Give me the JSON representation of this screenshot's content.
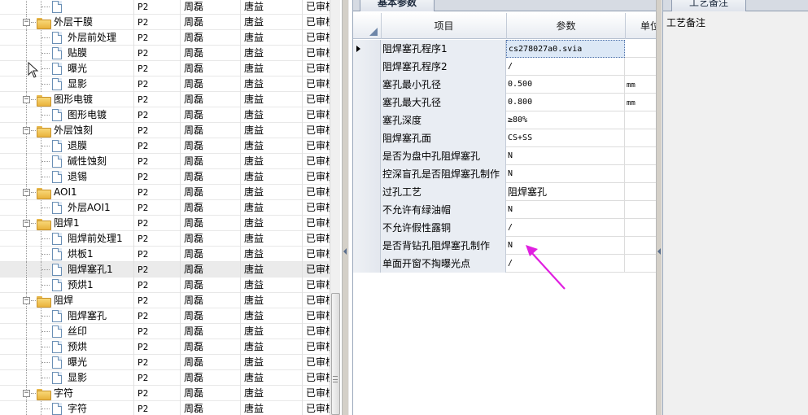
{
  "tree": {
    "rows": [
      {
        "kind": "doc",
        "label": "",
        "version": "P2",
        "maker": "周磊",
        "auditor": "唐益",
        "status": "已审核"
      },
      {
        "kind": "folder",
        "label": "外层干膜",
        "version": "P2",
        "maker": "周磊",
        "auditor": "唐益",
        "status": "已审核"
      },
      {
        "kind": "doc",
        "label": "外层前处理",
        "version": "P2",
        "maker": "周磊",
        "auditor": "唐益",
        "status": "已审核"
      },
      {
        "kind": "doc",
        "label": "贴膜",
        "version": "P2",
        "maker": "周磊",
        "auditor": "唐益",
        "status": "已审核"
      },
      {
        "kind": "doc",
        "label": "曝光",
        "version": "P2",
        "maker": "周磊",
        "auditor": "唐益",
        "status": "已审核"
      },
      {
        "kind": "doc",
        "label": "显影",
        "version": "P2",
        "maker": "周磊",
        "auditor": "唐益",
        "status": "已审核"
      },
      {
        "kind": "folder",
        "label": "图形电镀",
        "version": "P2",
        "maker": "周磊",
        "auditor": "唐益",
        "status": "已审核"
      },
      {
        "kind": "doc",
        "label": "图形电镀",
        "version": "P2",
        "maker": "周磊",
        "auditor": "唐益",
        "status": "已审核"
      },
      {
        "kind": "folder",
        "label": "外层蚀刻",
        "version": "P2",
        "maker": "周磊",
        "auditor": "唐益",
        "status": "已审核"
      },
      {
        "kind": "doc",
        "label": "退膜",
        "version": "P2",
        "maker": "周磊",
        "auditor": "唐益",
        "status": "已审核"
      },
      {
        "kind": "doc",
        "label": "碱性蚀刻",
        "version": "P2",
        "maker": "周磊",
        "auditor": "唐益",
        "status": "已审核"
      },
      {
        "kind": "doc",
        "label": "退锡",
        "version": "P2",
        "maker": "周磊",
        "auditor": "唐益",
        "status": "已审核"
      },
      {
        "kind": "folder",
        "label": "AOI1",
        "version": "P2",
        "maker": "周磊",
        "auditor": "唐益",
        "status": "已审核"
      },
      {
        "kind": "doc",
        "label": "外层AOI1",
        "version": "P2",
        "maker": "周磊",
        "auditor": "唐益",
        "status": "已审核"
      },
      {
        "kind": "folder",
        "label": "阻焊1",
        "version": "P2",
        "maker": "周磊",
        "auditor": "唐益",
        "status": "已审核"
      },
      {
        "kind": "doc",
        "label": "阻焊前处理1",
        "version": "P2",
        "maker": "周磊",
        "auditor": "唐益",
        "status": "已审核"
      },
      {
        "kind": "doc",
        "label": "烘板1",
        "version": "P2",
        "maker": "周磊",
        "auditor": "唐益",
        "status": "已审核"
      },
      {
        "kind": "doc",
        "label": "阻焊塞孔1",
        "version": "P2",
        "maker": "周磊",
        "auditor": "唐益",
        "status": "已审核",
        "selected": true
      },
      {
        "kind": "doc",
        "label": "预烘1",
        "version": "P2",
        "maker": "周磊",
        "auditor": "唐益",
        "status": "已审核"
      },
      {
        "kind": "folder",
        "label": "阻焊",
        "version": "P2",
        "maker": "周磊",
        "auditor": "唐益",
        "status": "已审核"
      },
      {
        "kind": "doc",
        "label": "阻焊塞孔",
        "version": "P2",
        "maker": "周磊",
        "auditor": "唐益",
        "status": "已审核"
      },
      {
        "kind": "doc",
        "label": "丝印",
        "version": "P2",
        "maker": "周磊",
        "auditor": "唐益",
        "status": "已审核"
      },
      {
        "kind": "doc",
        "label": "预烘",
        "version": "P2",
        "maker": "周磊",
        "auditor": "唐益",
        "status": "已审核"
      },
      {
        "kind": "doc",
        "label": "曝光",
        "version": "P2",
        "maker": "周磊",
        "auditor": "唐益",
        "status": "已审核"
      },
      {
        "kind": "doc",
        "label": "显影",
        "version": "P2",
        "maker": "周磊",
        "auditor": "唐益",
        "status": "已审核"
      },
      {
        "kind": "folder",
        "label": "字符",
        "version": "P2",
        "maker": "周磊",
        "auditor": "唐益",
        "status": "已审核"
      },
      {
        "kind": "doc",
        "label": "字符",
        "version": "P2",
        "maker": "周磊",
        "auditor": "唐益",
        "status": "已审核"
      },
      {
        "kind": "doc",
        "label": "",
        "version": "",
        "maker": "",
        "auditor": "",
        "status": ""
      }
    ]
  },
  "params": {
    "tab_label": "基本参数",
    "headers": {
      "item": "项目",
      "param": "参数",
      "unit": "单位"
    },
    "rows": [
      {
        "name": "阻焊塞孔程序1",
        "value": "cs278027a0.svia",
        "unit": "",
        "current": true
      },
      {
        "name": "阻焊塞孔程序2",
        "value": "/",
        "unit": ""
      },
      {
        "name": "塞孔最小孔径",
        "value": "0.500",
        "unit": "mm"
      },
      {
        "name": "塞孔最大孔径",
        "value": "0.800",
        "unit": "mm"
      },
      {
        "name": "塞孔深度",
        "value": "≥80%",
        "unit": ""
      },
      {
        "name": "阻焊塞孔面",
        "value": "CS+SS",
        "unit": ""
      },
      {
        "name": "是否为盘中孔阻焊塞孔",
        "value": "N",
        "unit": ""
      },
      {
        "name": "控深盲孔是否阻焊塞孔制作",
        "value": "N",
        "unit": ""
      },
      {
        "name": "过孔工艺",
        "value": "阻焊塞孔",
        "unit": ""
      },
      {
        "name": "不允许有绿油帽",
        "value": "N",
        "unit": ""
      },
      {
        "name": "不允许假性露铜",
        "value": "/",
        "unit": ""
      },
      {
        "name": "是否背钻孔阻焊塞孔制作",
        "value": "N",
        "unit": ""
      },
      {
        "name": "单面开窗不掏曝光点",
        "value": "/",
        "unit": ""
      }
    ]
  },
  "notes": {
    "tab_label": "工艺备注",
    "label": "工艺备注"
  },
  "colors": {
    "annotation_arrow": "#e020e0",
    "row_selected": "#ebebeb",
    "active_cell": "#dce8f6"
  }
}
